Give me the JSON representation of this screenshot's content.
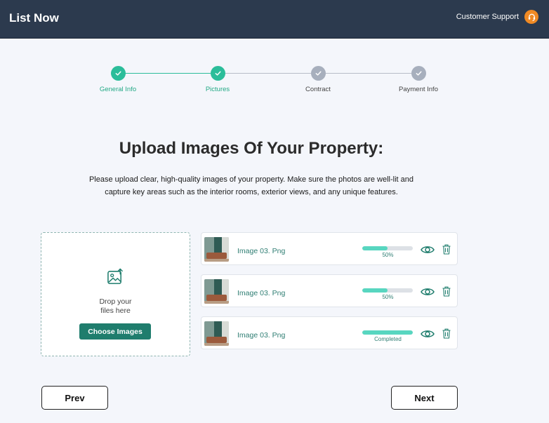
{
  "header": {
    "brand": "List Now",
    "support_label": "Customer Support",
    "support_icon": "headset-icon"
  },
  "stepper": {
    "steps": [
      {
        "label": "General Info",
        "status": "completed"
      },
      {
        "label": "Pictures",
        "status": "completed"
      },
      {
        "label": "Contract",
        "status": "pending"
      },
      {
        "label": "Payment Info",
        "status": "pending"
      }
    ]
  },
  "main": {
    "title": "Upload Images Of Your Property:",
    "description_line1": "Please upload clear, high-quality images of your property. Make sure the photos are well-lit and",
    "description_line2": "capture key areas such as the interior rooms, exterior views, and any unique features."
  },
  "dropzone": {
    "icon": "image-upload-icon",
    "text_line1": "Drop your",
    "text_line2": "files here",
    "button_label": "Choose Images"
  },
  "files": [
    {
      "name": "Image 03. Png",
      "progress": 0.5,
      "status_text": "50%"
    },
    {
      "name": "Image 03. Png",
      "progress": 0.5,
      "status_text": "50%"
    },
    {
      "name": "Image 03. Png",
      "progress": 1.0,
      "status_text": "Completed"
    }
  ],
  "navigation": {
    "prev_label": "Prev",
    "next_label": "Next"
  },
  "colors": {
    "header_bg": "#2c3a4e",
    "accent": "#1f7d6d",
    "step_done": "#2bbd9a",
    "step_pending": "#a7afbd",
    "progress_fill": "#58d6c0",
    "support_icon_bg": "#f08a24"
  }
}
